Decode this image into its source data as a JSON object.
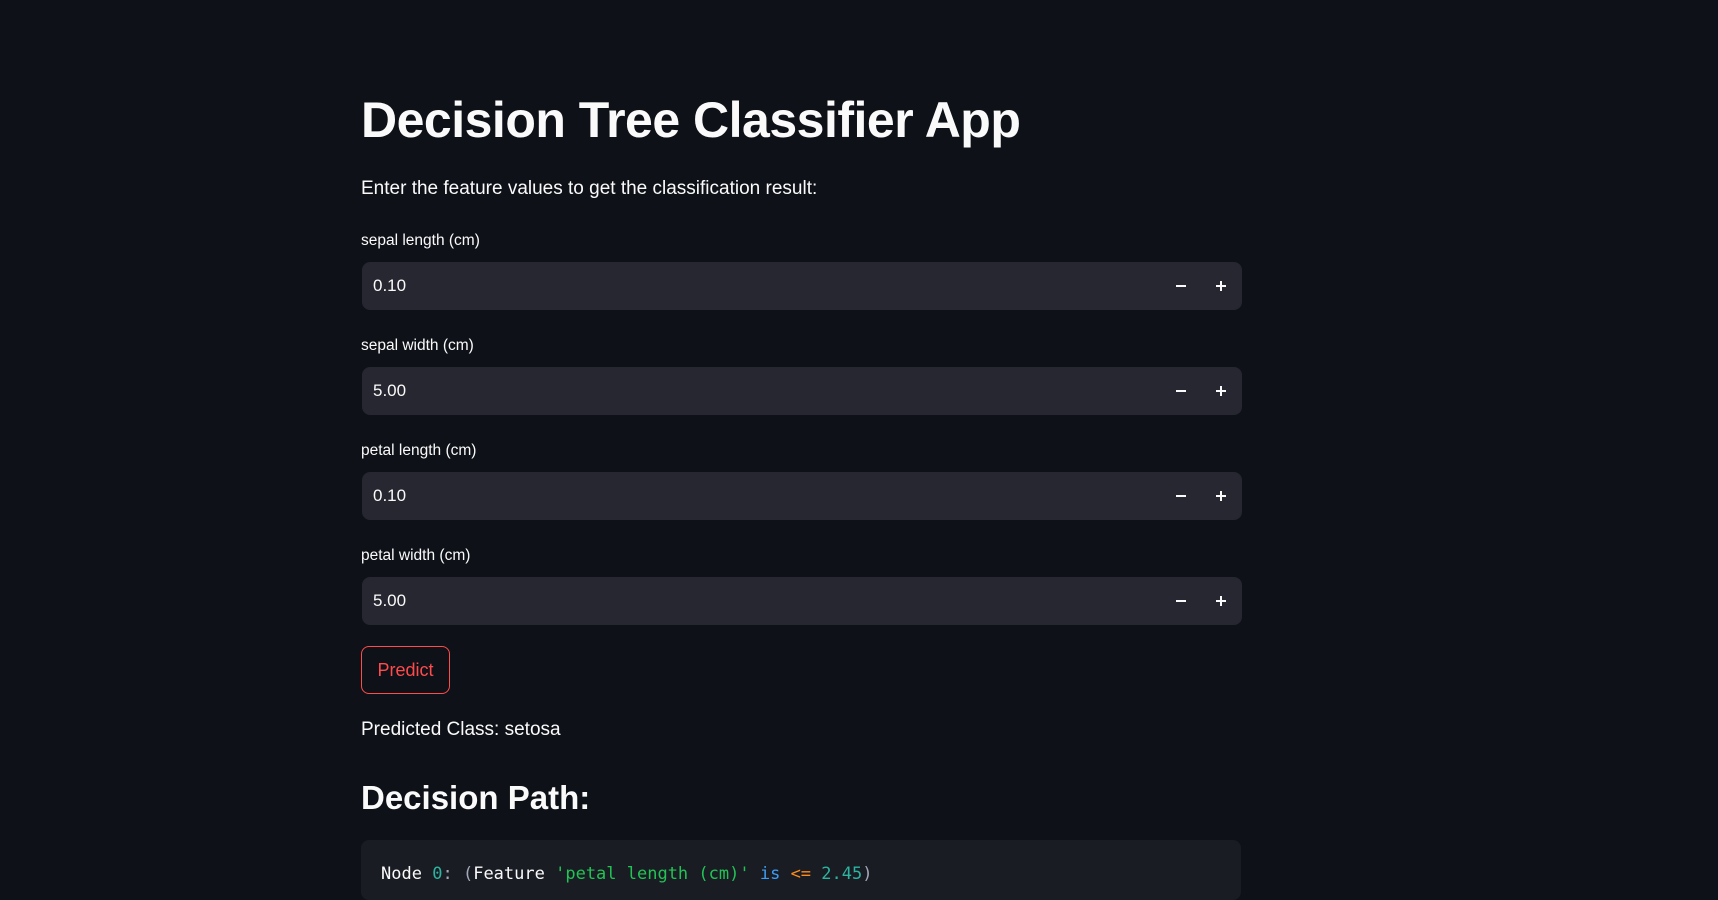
{
  "page": {
    "title": "Decision Tree Classifier App",
    "intro": "Enter the feature values to get the classification result:"
  },
  "features": [
    {
      "label": "sepal length (cm)",
      "value": "0.10"
    },
    {
      "label": "sepal width (cm)",
      "value": "5.00"
    },
    {
      "label": "petal length (cm)",
      "value": "0.10"
    },
    {
      "label": "petal width (cm)",
      "value": "5.00"
    }
  ],
  "icons": {
    "decrement": "minus-icon",
    "increment": "plus-icon"
  },
  "predict": {
    "label": "Predict"
  },
  "result": {
    "text": "Predicted Class: setosa"
  },
  "decision_path": {
    "heading": "Decision Path:",
    "lines": [
      {
        "node_word": "Node",
        "node_id": "0",
        "colon": ":",
        "open_paren": "(",
        "feature_word": "Feature",
        "feature_name": "'petal length (cm)'",
        "is_word": "is",
        "operator": "<=",
        "threshold": "2.45",
        "close_paren": ")"
      }
    ]
  },
  "colors": {
    "background": "#0e1117",
    "input_background": "#262730",
    "accent": "#ff4b4b",
    "code_background": "#1a1c24"
  }
}
